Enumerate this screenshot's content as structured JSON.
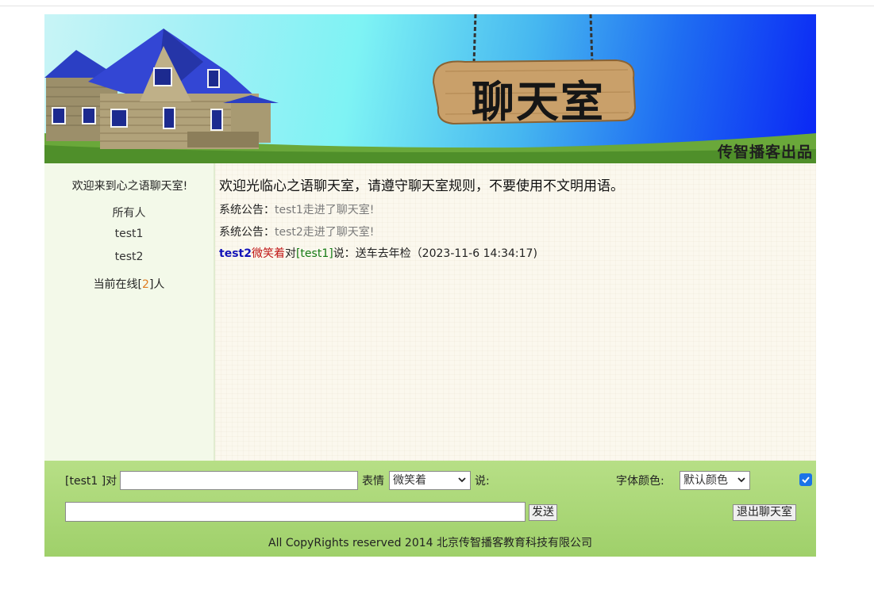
{
  "banner": {
    "sign_text": "聊天室",
    "credit": "传智播客出品"
  },
  "sidebar": {
    "welcome": "欢迎来到心之语聊天室!",
    "users": [
      "所有人",
      "test1",
      "test2"
    ],
    "online_prefix": "当前在线[",
    "online_count": "2",
    "online_suffix": "]人"
  },
  "messages": {
    "welcome": "欢迎光临心之语聊天室，请遵守聊天室规则，不要使用不文明用语。",
    "system": [
      {
        "prefix": "系统公告：",
        "text": "test1走进了聊天室!"
      },
      {
        "prefix": "系统公告：",
        "text": "test2走进了聊天室!"
      }
    ],
    "chat": {
      "sender": "test2",
      "mood": "微笑着",
      "to_word": "对",
      "target": "[test1]",
      "say_word": "说：",
      "content": "送车去年检（2023-11-6 14:34:17)"
    }
  },
  "panel": {
    "to_label": "[test1 ]对",
    "to_value": "",
    "mood_label": "表情",
    "mood_selected": "微笑着",
    "say_label": "说:",
    "color_label": "字体颜色:",
    "color_selected": "默认颜色",
    "checkbox_checked": true,
    "message_value": "",
    "send_label": "发送",
    "exit_label": "退出聊天室",
    "footer": "All CopyRights reserved 2014 北京传智播客教育科技有限公司"
  },
  "colors": {
    "sender": "#1313b8",
    "mood": "#c01515",
    "target": "#147a14",
    "online_count": "#e07b1f",
    "checkbox": "#1a73e8",
    "panel": "#aed779"
  }
}
